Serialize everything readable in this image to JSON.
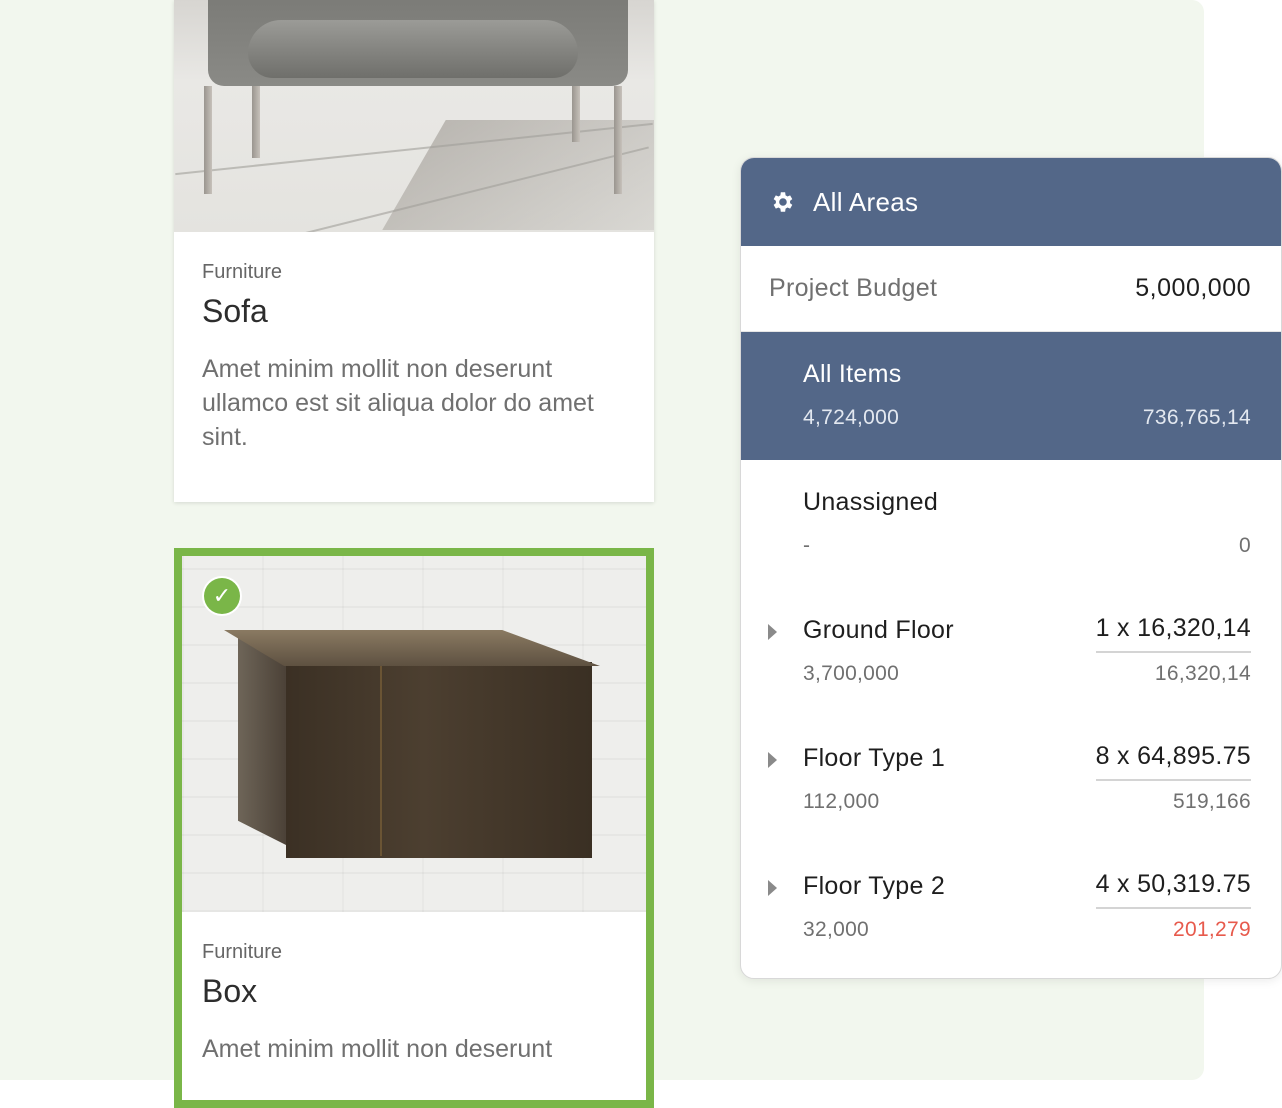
{
  "cards": [
    {
      "image": "armchair-photo",
      "category": "Furniture",
      "title": "Sofa",
      "description": "Amet minim mollit non deserunt ullamco est sit aliqua dolor do amet sint."
    },
    {
      "image": "mailbox-photo",
      "category": "Furniture",
      "title": "Box",
      "description": "Amet minim mollit non deserunt",
      "selected": true,
      "selected_icon": "check-icon",
      "selected_icon_glyph": "✓"
    }
  ],
  "panel": {
    "icon": "gear-icon",
    "title": "All Areas",
    "budget_label": "Project Budget",
    "budget_value": "5,000,000",
    "rows": [
      {
        "name": "All Items",
        "left": "4,724,000",
        "right": "736,765,14",
        "selected": true
      },
      {
        "name": "Unassigned",
        "left": "-",
        "right": "0"
      },
      {
        "name": "Ground Floor",
        "qty": "1 x 16,320,14",
        "left": "3,700,000",
        "right": "16,320,14",
        "expandable": true
      },
      {
        "name": "Floor Type 1",
        "qty": "8 x 64,895.75",
        "left": "112,000",
        "right": "519,166",
        "expandable": true
      },
      {
        "name": "Floor Type 2",
        "qty": "4 x 50,319.75",
        "left": "32,000",
        "right": "201,279",
        "expandable": true,
        "over_budget": true
      }
    ]
  },
  "colors": {
    "accent_green": "#7ab648",
    "panel_header": "#536788",
    "over_budget": "#e75a4c",
    "background": "#f2f7ee"
  }
}
